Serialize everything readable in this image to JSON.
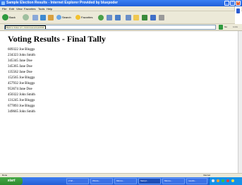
{
  "window": {
    "title": "Sample Election Results - Internet Explorer Provided by bluepoder"
  },
  "menu": [
    "File",
    "Edit",
    "View",
    "Favorites",
    "Tools",
    "Help"
  ],
  "toolbar": {
    "back_label": "Back",
    "search_label": "Search",
    "favorites_label": "Favorites"
  },
  "address": {
    "tooltip": "Back to Index of /~/microresources/2011",
    "go_label": "Go",
    "links_label": "Links"
  },
  "page": {
    "heading": "Voting Results - Final Tally",
    "results": [
      "609322 Joe Bloggs",
      "234323 John Smith",
      "345345 Jane Doe",
      "345365 Jane Doe",
      "135562 Jane Doe",
      "152565 Joe Bloggs",
      "457932 Joe Bloggs",
      "953674 Jane Doe",
      "450322 John Smith",
      "131245 Joe Bloggs",
      "677893 Joe Bloggs",
      "349665 John Smith"
    ]
  },
  "status": {
    "left": "Done",
    "zone": "Internet"
  },
  "taskbar": {
    "start_label": "start",
    "tasks": [
      "2 Wi...",
      "Windo...",
      "Micros...",
      "Sampl...",
      "Micros...",
      "results..."
    ]
  }
}
